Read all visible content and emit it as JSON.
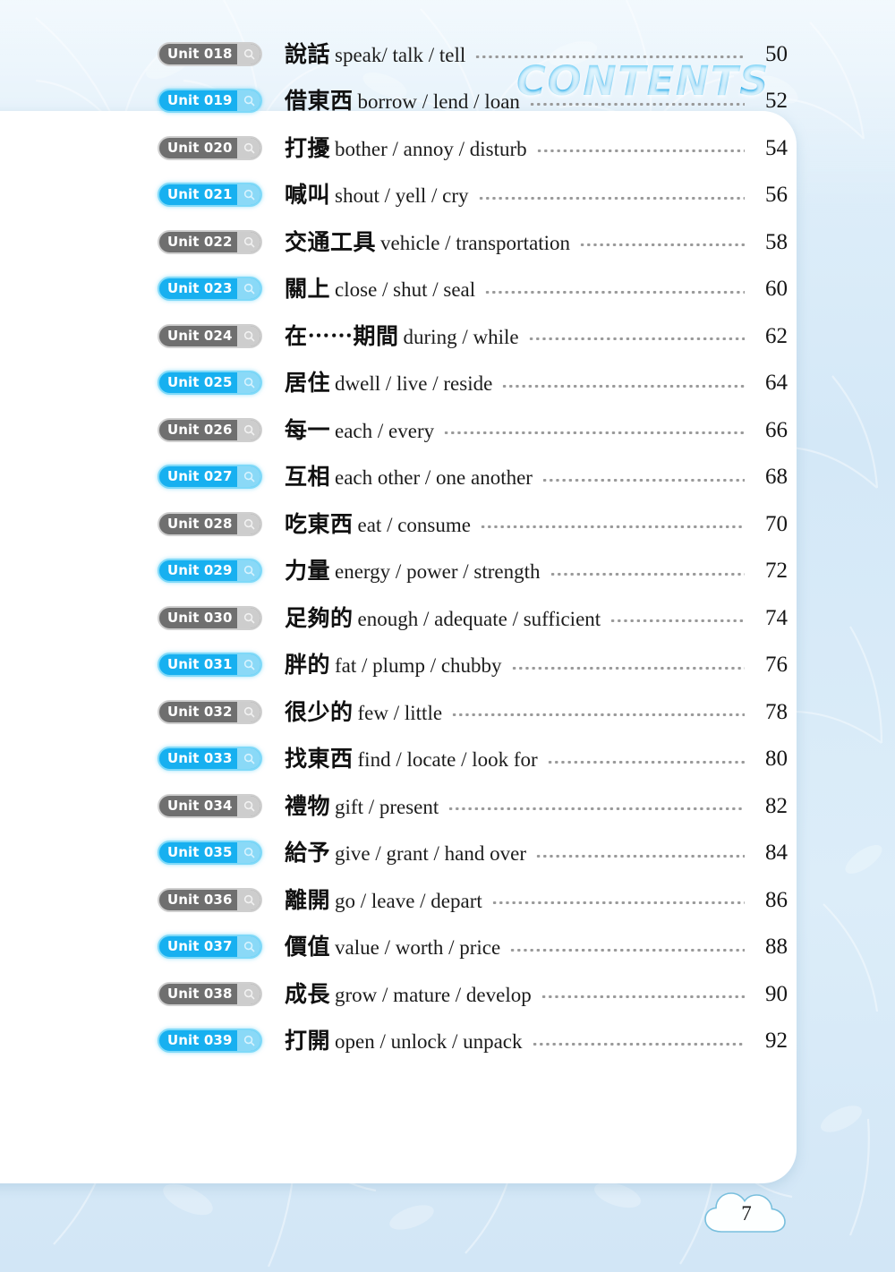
{
  "header": {
    "title": "CONTENTS"
  },
  "colors": {
    "page_background": "#d6e9f7",
    "card_background": "#ffffff",
    "badge_blue": "#17b0f0",
    "badge_gray": "#6f6f6f",
    "title_blue": "#17a3e8",
    "leader_dots": "#9a9a9a"
  },
  "icons": {
    "badge_lens": "magnifier-icon"
  },
  "toc": {
    "entries": [
      {
        "unit": "Unit 018",
        "style": "gray",
        "zh": "說話",
        "en": "speak/ talk / tell",
        "page": "50"
      },
      {
        "unit": "Unit 019",
        "style": "blue",
        "zh": "借東西",
        "en": "borrow / lend / loan",
        "page": "52"
      },
      {
        "unit": "Unit 020",
        "style": "gray",
        "zh": "打擾",
        "en": "bother / annoy / disturb",
        "page": "54"
      },
      {
        "unit": "Unit 021",
        "style": "blue",
        "zh": "喊叫",
        "en": "shout / yell / cry",
        "page": "56"
      },
      {
        "unit": "Unit 022",
        "style": "gray",
        "zh": "交通工具",
        "en": "vehicle / transportation",
        "page": "58"
      },
      {
        "unit": "Unit 023",
        "style": "blue",
        "zh": "關上",
        "en": "close / shut / seal",
        "page": "60"
      },
      {
        "unit": "Unit 024",
        "style": "gray",
        "zh": "在⋯⋯期間",
        "en": "during / while",
        "page": "62"
      },
      {
        "unit": "Unit 025",
        "style": "blue",
        "zh": "居住",
        "en": "dwell / live / reside",
        "page": "64"
      },
      {
        "unit": "Unit 026",
        "style": "gray",
        "zh": "每一",
        "en": "each / every",
        "page": "66"
      },
      {
        "unit": "Unit 027",
        "style": "blue",
        "zh": "互相",
        "en": "each other / one another",
        "page": "68"
      },
      {
        "unit": "Unit 028",
        "style": "gray",
        "zh": "吃東西",
        "en": "eat / consume",
        "page": "70"
      },
      {
        "unit": "Unit 029",
        "style": "blue",
        "zh": "力量",
        "en": "energy / power / strength",
        "page": "72"
      },
      {
        "unit": "Unit 030",
        "style": "gray",
        "zh": "足夠的",
        "en": "enough / adequate / sufficient",
        "page": "74"
      },
      {
        "unit": "Unit 031",
        "style": "blue",
        "zh": "胖的",
        "en": "fat / plump / chubby",
        "page": "76"
      },
      {
        "unit": "Unit 032",
        "style": "gray",
        "zh": "很少的",
        "en": "few / little",
        "page": "78"
      },
      {
        "unit": "Unit 033",
        "style": "blue",
        "zh": "找東西",
        "en": "find / locate / look for",
        "page": "80"
      },
      {
        "unit": "Unit 034",
        "style": "gray",
        "zh": "禮物",
        "en": "gift / present",
        "page": "82"
      },
      {
        "unit": "Unit 035",
        "style": "blue",
        "zh": "給予",
        "en": "give / grant / hand over",
        "page": "84"
      },
      {
        "unit": "Unit 036",
        "style": "gray",
        "zh": "離開",
        "en": "go / leave / depart",
        "page": "86"
      },
      {
        "unit": "Unit 037",
        "style": "blue",
        "zh": "價值",
        "en": "value / worth / price",
        "page": "88"
      },
      {
        "unit": "Unit 038",
        "style": "gray",
        "zh": "成長",
        "en": "grow / mature / develop",
        "page": "90"
      },
      {
        "unit": "Unit 039",
        "style": "blue",
        "zh": "打開",
        "en": "open / unlock / unpack",
        "page": "92"
      }
    ]
  },
  "footer": {
    "page_number": "7"
  }
}
